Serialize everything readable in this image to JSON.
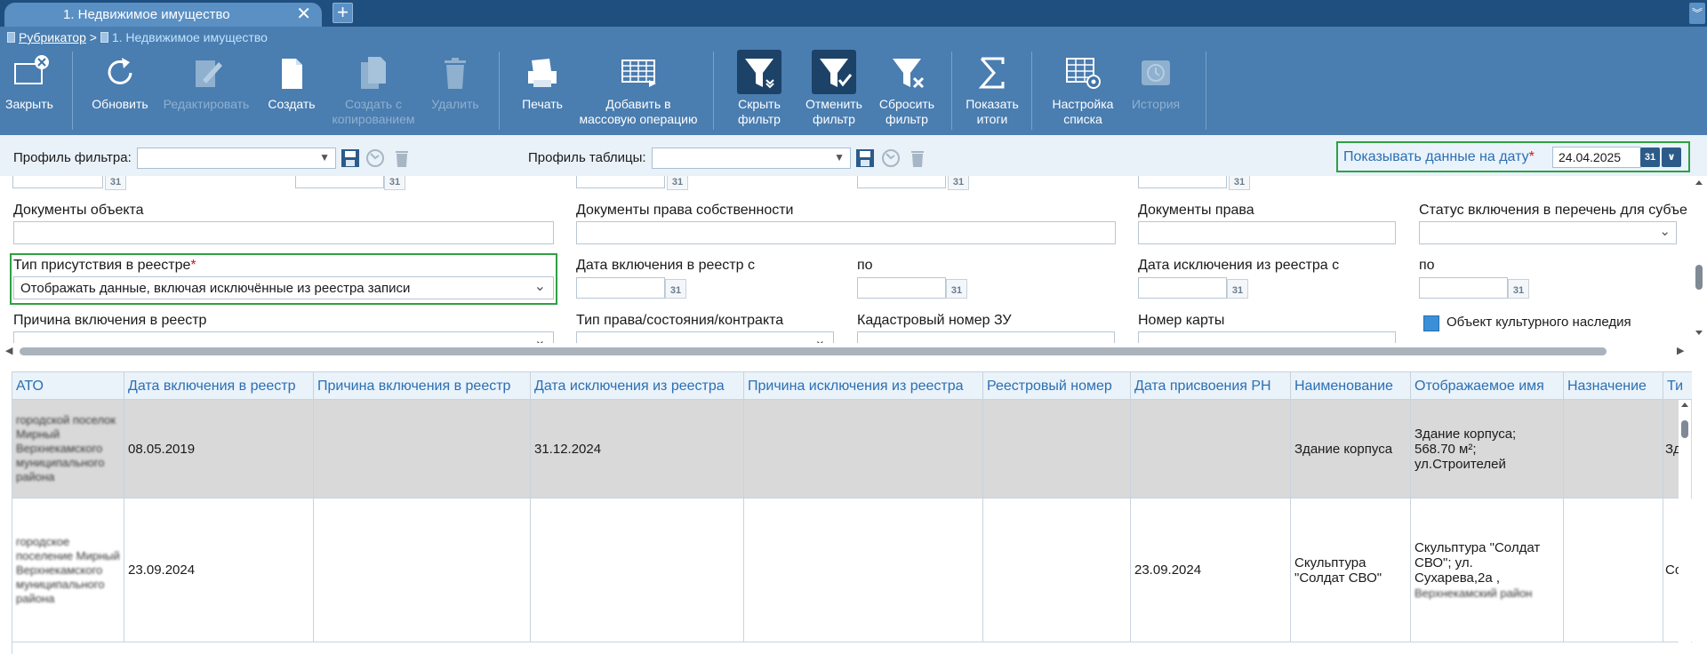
{
  "tab": {
    "title": "1. Недвижимое имущество",
    "add_label": "+"
  },
  "breadcrumb": {
    "root": "Рубрикатор",
    "sep": ">",
    "current": "1. Недвижимое имущество"
  },
  "toolbar": {
    "close": "Закрыть",
    "refresh": "Обновить",
    "edit": "Редактировать",
    "create": "Создать",
    "create_copy_1": "Создать с",
    "create_copy_2": "копированием",
    "delete": "Удалить",
    "print": "Печать",
    "mass_1": "Добавить в",
    "mass_2": "массовую операцию",
    "hide_filter_1": "Скрыть",
    "hide_filter_2": "фильтр",
    "cancel_filter_1": "Отменить",
    "cancel_filter_2": "фильтр",
    "reset_filter_1": "Сбросить",
    "reset_filter_2": "фильтр",
    "totals_1": "Показать",
    "totals_2": "итоги",
    "settings_1": "Настройка",
    "settings_2": "списка",
    "history": "История"
  },
  "filterbar": {
    "filter_profile_label": "Профиль фильтра:",
    "table_profile_label": "Профиль таблицы:",
    "show_date_label": "Показывать данные на дату",
    "required_mark": "*",
    "show_date_value": "24.04.2025"
  },
  "form": {
    "cal": "31",
    "object_docs": "Документы объекта",
    "ownership_docs": "Документы права собственности",
    "right_docs": "Документы права",
    "inclusion_status": "Статус включения в перечень для субъе",
    "presence_type": "Тип присутствия в реестре",
    "presence_value": "Отображать данные, включая исключённые из реестра записи",
    "incl_date_from": "Дата включения в реестр с",
    "to_1": "по",
    "excl_date_from": "Дата исключения из реестра с",
    "to_2": "по",
    "incl_reason": "Причина включения в реестр",
    "right_type": "Тип права/состояния/контракта",
    "cadastral": "Кадастровый номер ЗУ",
    "map_number": "Номер карты",
    "cultural": "Объект культурного наследия"
  },
  "grid": {
    "headers": [
      "АТО",
      "Дата включения в реестр",
      "Причина включения в реестр",
      "Дата исключения из реестра",
      "Причина исключения из реестра",
      "Реестровый номер",
      "Дата присвоения РН",
      "Наименование",
      "Отображаемое имя",
      "Назначение",
      "Ти"
    ],
    "rows": [
      {
        "ato": "городской поселок Мирный Верхнекамского муниципального района",
        "incl_date": "08.05.2019",
        "incl_reason": "",
        "excl_date": "31.12.2024",
        "excl_reason": "",
        "reg_num": "",
        "rn_date": "",
        "name": "Здание корпуса",
        "display_1": "Здание корпуса;",
        "display_2": "568.70 м²;",
        "display_3": "ул.Строителей",
        "purpose": "",
        "type": "Зд"
      },
      {
        "ato": "городское поселение Мирный Верхнекамского муниципального района",
        "incl_date": "23.09.2024",
        "incl_reason": "",
        "excl_date": "",
        "excl_reason": "",
        "reg_num": "",
        "rn_date": "23.09.2024",
        "name_1": "Скульптура",
        "name_2": "\"Солдат СВО\"",
        "display_1": "Скульптура \"Солдат",
        "display_2": "СВО\"; ул.",
        "display_3": "Сухарева,2а ,",
        "display_4": "Верхнекамский район",
        "purpose": "",
        "type": "Со"
      }
    ]
  }
}
